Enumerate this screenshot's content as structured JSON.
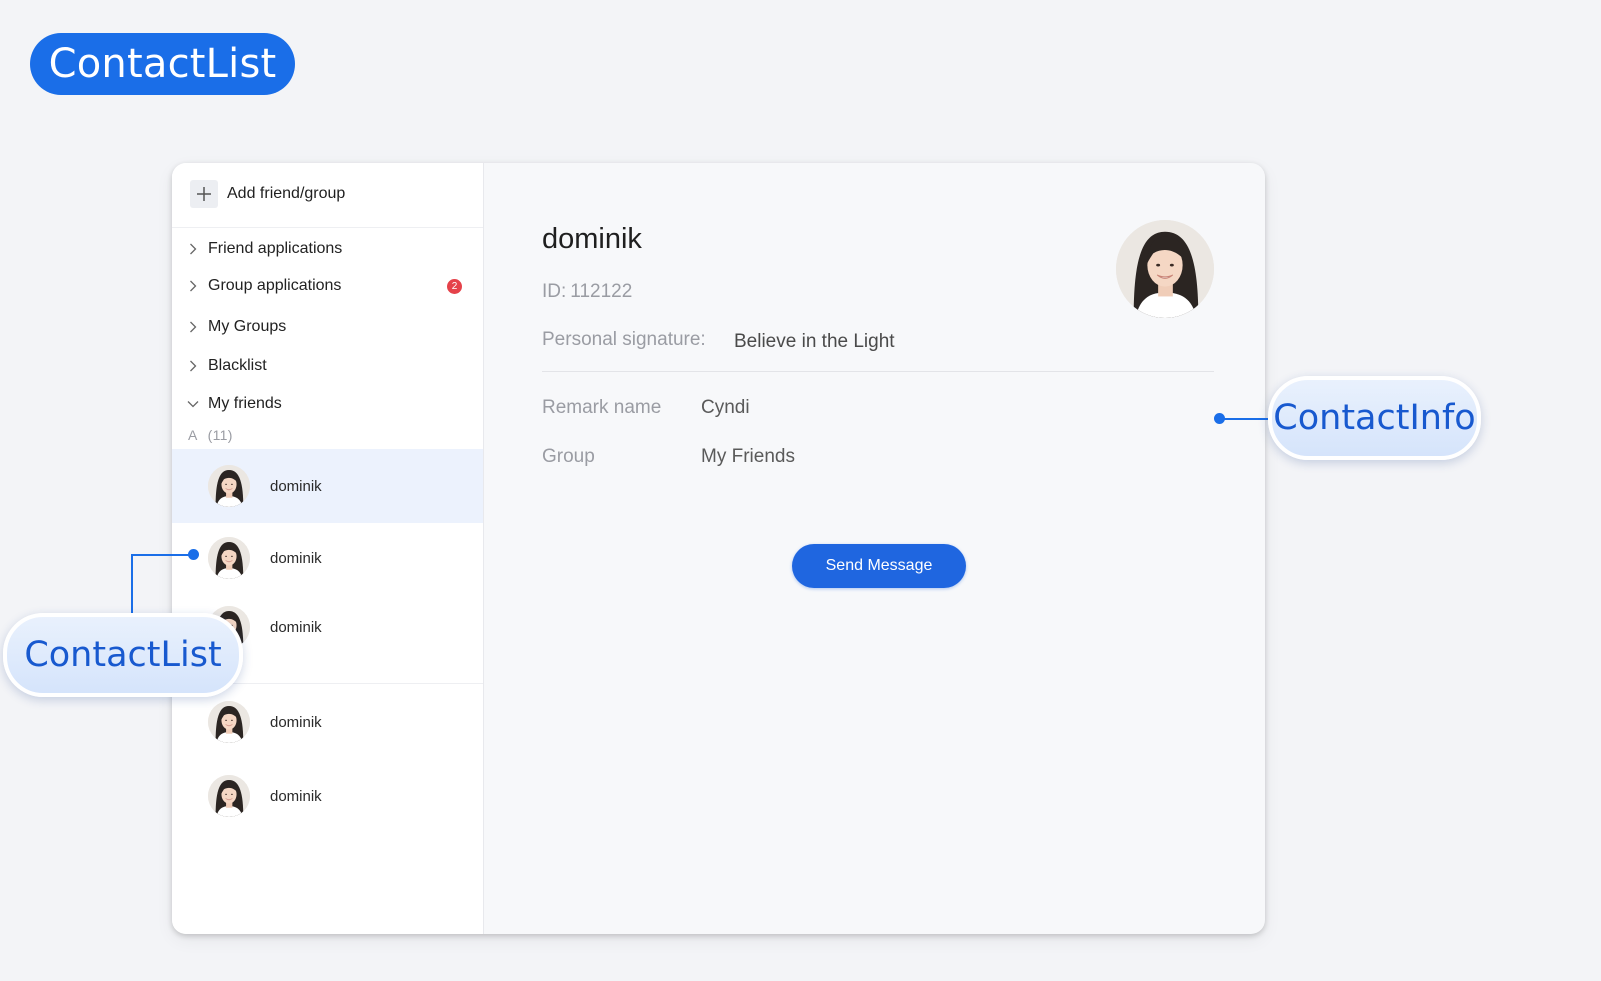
{
  "page": {
    "title_pill": "ContactList"
  },
  "sidebar": {
    "add_label": "Add friend/group",
    "items": [
      {
        "label": "Friend applications"
      },
      {
        "label": "Group applications",
        "badge": "2"
      },
      {
        "label": "My Groups"
      },
      {
        "label": "Blacklist"
      },
      {
        "label": "My friends"
      }
    ],
    "group_letter": "A",
    "group_count": "(11)",
    "contacts": [
      {
        "name": "dominik",
        "selected": true
      },
      {
        "name": "dominik"
      },
      {
        "name": "dominik"
      },
      {
        "name": "dominik"
      },
      {
        "name": "dominik"
      }
    ]
  },
  "detail": {
    "name": "dominik",
    "id_label": "ID:",
    "id_value": "112122",
    "signature_label": "Personal signature:",
    "signature_value": "Believe in the Light",
    "remark_label": "Remark name",
    "remark_value": "Cyndi",
    "group_label": "Group",
    "group_value": "My Friends",
    "send_button": "Send Message"
  },
  "callouts": {
    "contact_info": "ContactInfo",
    "contact_list": "ContactList"
  },
  "colors": {
    "accent": "#1a6ee8",
    "button": "#1f66e0",
    "badge": "#e5424a",
    "selected_row": "#ecf2fd"
  }
}
